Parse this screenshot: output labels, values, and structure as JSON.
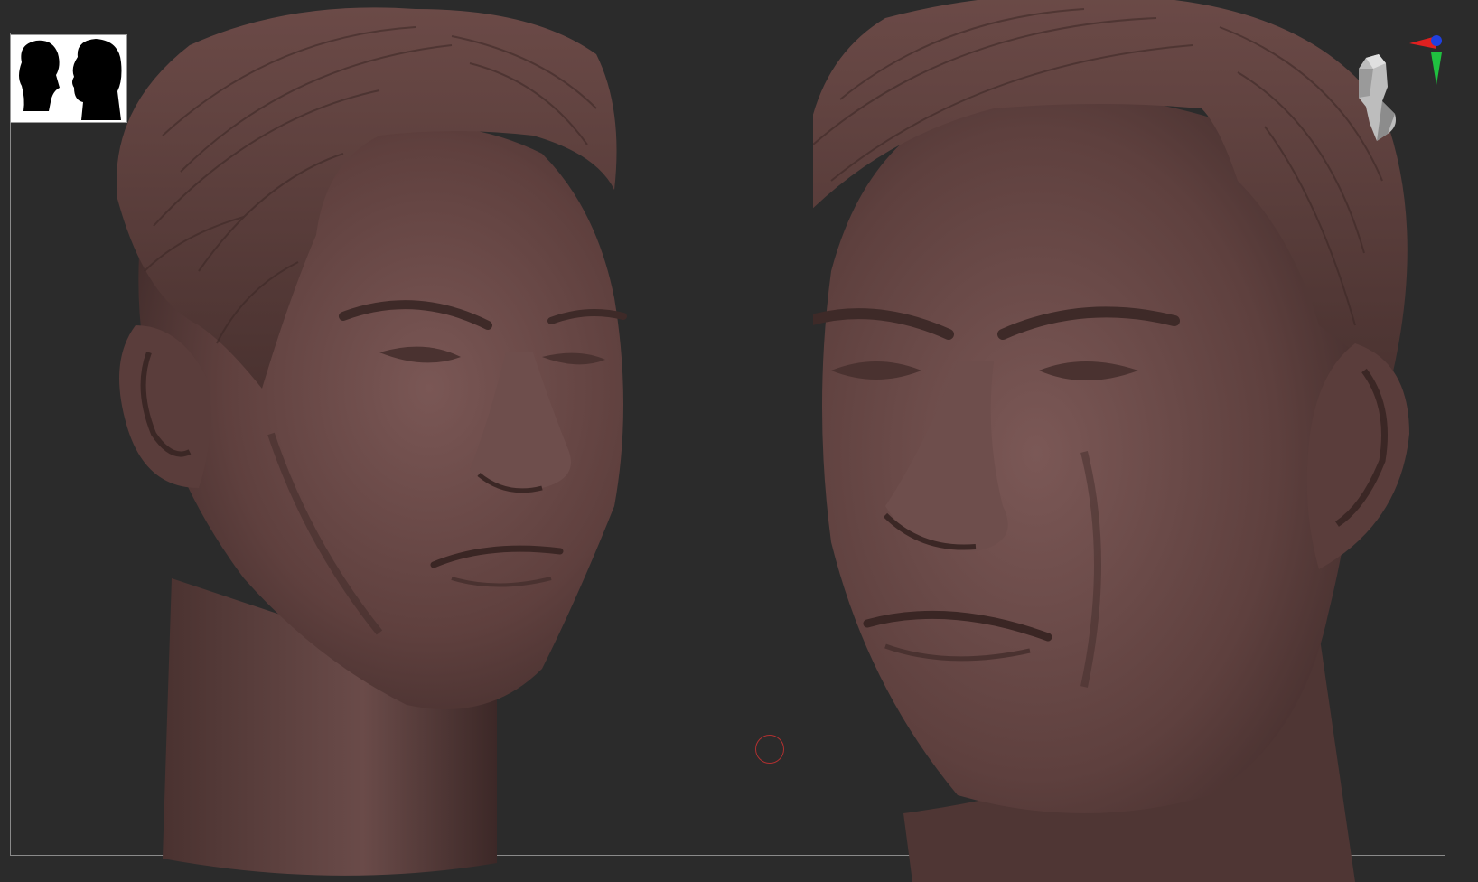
{
  "app": {
    "type": "3d-sculpt-viewport"
  },
  "viewport": {
    "background": "#2b2b2b",
    "frame_color": "#8a8a8a",
    "model_color": "#6a4a48",
    "hair_color": "#5e3f3c",
    "icons": {
      "silhouette": "head-silhouette-icon",
      "navigator": "head-navigator-icon",
      "axis": "axis-gizmo-icon",
      "cursor": "brush-cursor-icon"
    },
    "axis_colors": {
      "x": "#e02020",
      "y": "#20c040",
      "z": "#2040e0"
    }
  }
}
